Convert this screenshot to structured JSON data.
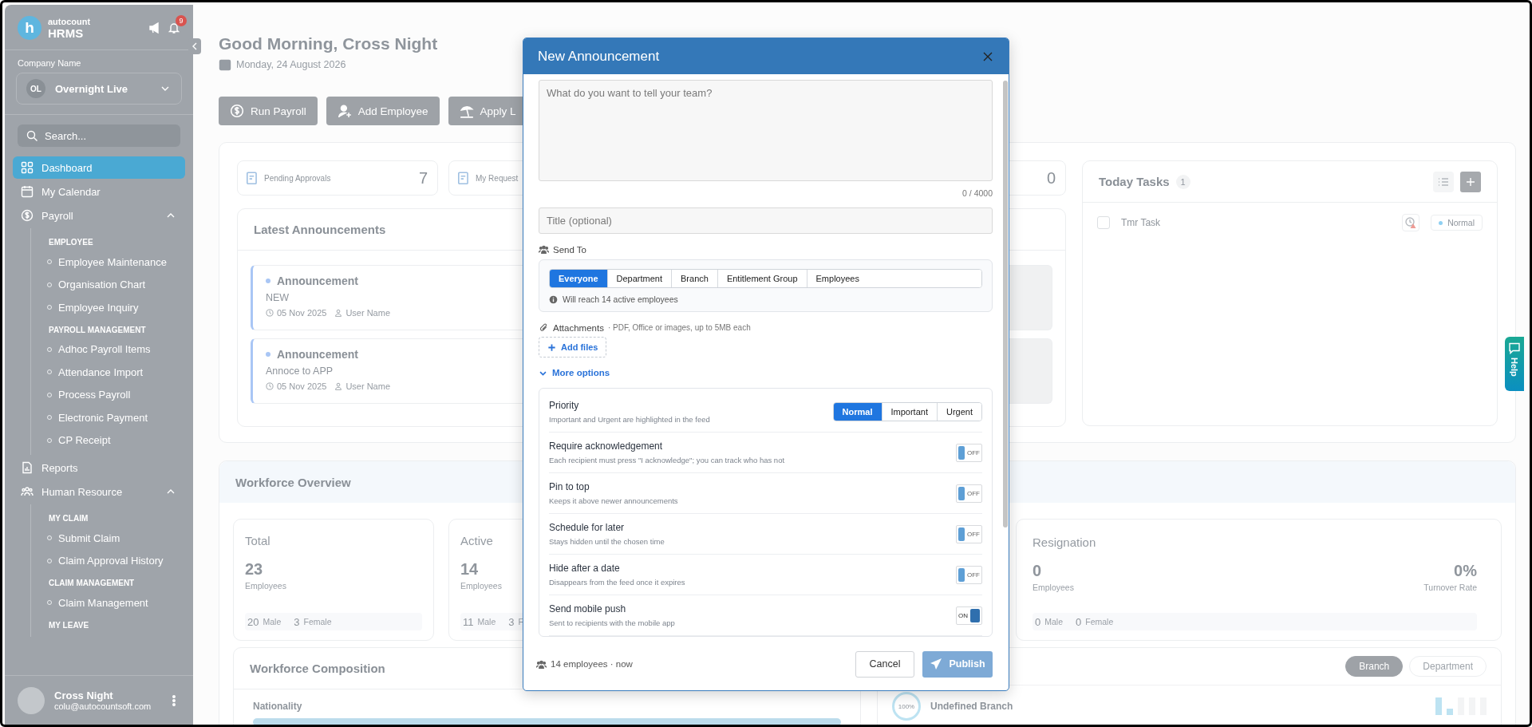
{
  "sidebar": {
    "logo_letter": "h",
    "brand_top": "autocount",
    "brand_bottom": "HRMS",
    "notifications": "9",
    "company_label": "Company Name",
    "company": {
      "initials": "OL",
      "name": "Overnight Live"
    },
    "search": {
      "placeholder": "Search..."
    },
    "nav": [
      {
        "kind": "link",
        "label": "Dashboard",
        "selected": true
      },
      {
        "kind": "link",
        "label": "My Calendar",
        "selected": false
      },
      {
        "kind": "group",
        "label": "Payroll",
        "selected": false,
        "expanded": true,
        "sections": [
          {
            "heading": "EMPLOYEE",
            "items": [
              {
                "label": "Employee Maintenance",
                "selected": false
              },
              {
                "label": "Organisation Chart",
                "selected": false
              },
              {
                "label": "Employee Inquiry",
                "selected": false
              }
            ]
          },
          {
            "heading": "PAYROLL MANAGEMENT",
            "items": [
              {
                "label": "Adhoc Payroll Items",
                "selected": false
              },
              {
                "label": "Attendance Import",
                "selected": false
              },
              {
                "label": "Process Payroll",
                "selected": false
              },
              {
                "label": "Electronic Payment",
                "selected": false
              },
              {
                "label": "CP Receipt",
                "selected": false
              }
            ]
          }
        ]
      },
      {
        "kind": "link",
        "label": "Reports",
        "selected": false
      },
      {
        "kind": "group",
        "label": "Human Resource",
        "selected": false,
        "expanded": true,
        "sections": [
          {
            "heading": "MY CLAIM",
            "items": [
              {
                "label": "Submit Claim",
                "selected": false
              },
              {
                "label": "Claim Approval History",
                "selected": false
              }
            ]
          },
          {
            "heading": "CLAIM MANAGEMENT",
            "items": [
              {
                "label": "Claim Management",
                "selected": false
              }
            ]
          },
          {
            "heading": "MY LEAVE"
          }
        ]
      }
    ],
    "user": {
      "name": "Cross Night",
      "email": "colu@autocountsoft.com"
    }
  },
  "header": {
    "greeting": "Good Morning, Cross Night",
    "date": "Monday, 24 August 2026"
  },
  "quick_actions": [
    "Run Payroll",
    "Add Employee",
    "Apply L"
  ],
  "stats": [
    {
      "label": "Pending Approvals",
      "value": "7"
    },
    {
      "label": "My Request"
    },
    {
      "value": "0"
    }
  ],
  "announcements": {
    "title": "Latest Announcements",
    "items": [
      {
        "title": "Announcement",
        "body": "NEW",
        "date": "05 Nov 2025",
        "author": "User Name"
      },
      {
        "title": "Announcement",
        "body": "Annoce to APP",
        "date": "05 Nov 2025",
        "author": "User Name"
      }
    ]
  },
  "tasks": {
    "title": "Today Tasks",
    "count": "1",
    "items": [
      {
        "label": "Tmr Task",
        "checked": false,
        "priority": "Normal"
      }
    ]
  },
  "workforce": {
    "title": "Workforce Overview",
    "cards": [
      {
        "kind": "gender",
        "title": "Total",
        "value": "23",
        "unit": "Employees",
        "male": "20",
        "male_label": "Male",
        "female": "3",
        "female_label": "Female"
      },
      {
        "kind": "gender",
        "title": "Active",
        "value": "14",
        "unit": "Employees",
        "male": "11",
        "male_label": "Male",
        "female": "3",
        "female_label": "F"
      },
      {
        "kind": "turnover",
        "title": "Resignation",
        "value": "0",
        "unit": "Employees",
        "rate": "0%",
        "rate_label": "Turnover Rate",
        "male": "0",
        "male_label": "Male",
        "female": "0",
        "female_label": "Female"
      }
    ],
    "composition": {
      "title": "Workforce Composition",
      "subtitle": "Nationality"
    },
    "distribution": {
      "tabs": [
        {
          "label": "Branch",
          "selected": true
        },
        {
          "label": "Department",
          "selected": false
        }
      ],
      "items": [
        {
          "name": "Undefined Branch",
          "percent": "100%"
        }
      ]
    }
  },
  "help": "Help",
  "dialog": {
    "title": "New Announcement",
    "message": {
      "placeholder": "What do you want to tell your team?",
      "counter": "0 / 4000"
    },
    "title_field": {
      "placeholder": "Title (optional)"
    },
    "send_to": {
      "label": "Send To",
      "options": [
        {
          "label": "Everyone",
          "selected": true
        },
        {
          "label": "Department",
          "selected": false
        },
        {
          "label": "Branch",
          "selected": false
        },
        {
          "label": "Entitlement Group",
          "selected": false
        },
        {
          "label": "Employees",
          "selected": false
        }
      ],
      "note": "Will reach 14 active employees"
    },
    "attachments": {
      "label": "Attachments",
      "hint": "· PDF, Office or images, up to 5MB each",
      "button": "Add files"
    },
    "more_options": {
      "label": "More options",
      "expanded": true
    },
    "priority": {
      "label": "Priority",
      "description": "Important and Urgent are highlighted in the feed",
      "options": [
        {
          "label": "Normal",
          "selected": true
        },
        {
          "label": "Important",
          "selected": false
        },
        {
          "label": "Urgent",
          "selected": false
        }
      ]
    },
    "toggles": [
      {
        "label": "Require acknowledgement",
        "description": "Each recipient must press \"I acknowledge\"; you can track who has not",
        "on": false,
        "state_text": "OFF"
      },
      {
        "label": "Pin to top",
        "description": "Keeps it above newer announcements",
        "on": false,
        "state_text": "OFF"
      },
      {
        "label": "Schedule for later",
        "description": "Stays hidden until the chosen time",
        "on": false,
        "state_text": "OFF"
      },
      {
        "label": "Hide after a date",
        "description": "Disappears from the feed once it expires",
        "on": false,
        "state_text": "OFF"
      },
      {
        "label": "Send mobile push",
        "description": "Sent to recipients with the mobile app",
        "on": true,
        "state_text": "ON"
      }
    ],
    "footer": {
      "summary": "14 employees · now",
      "cancel": "Cancel",
      "publish": {
        "label": "Publish",
        "disabled": true
      }
    }
  }
}
